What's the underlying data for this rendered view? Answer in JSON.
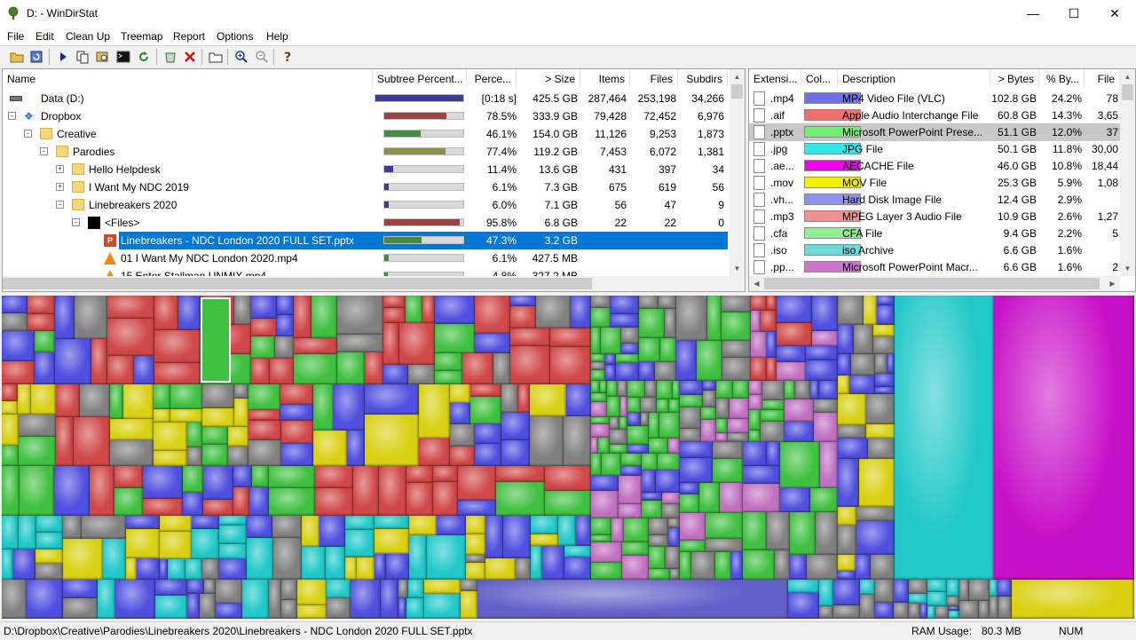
{
  "window": {
    "title": "D: - WinDirStat"
  },
  "menu": [
    "File",
    "Edit",
    "Clean Up",
    "Treemap",
    "Report",
    "Options",
    "Help"
  ],
  "dirtree": {
    "columns": [
      "Name",
      "Subtree Percent...",
      "Perce...",
      "> Size",
      "Items",
      "Files",
      "Subdirs"
    ],
    "rows": [
      {
        "name": "Data (D:)",
        "pct": "[0:18 s]",
        "size": "425.5 GB",
        "items": "287,464",
        "files": "253,198",
        "subdirs": "34,266",
        "bar": 1.0,
        "color": "#3a3aa0"
      },
      {
        "name": "Dropbox",
        "pct": "78.5%",
        "size": "333.9 GB",
        "items": "79,428",
        "files": "72,452",
        "subdirs": "6,976",
        "bar": 0.785,
        "color": "#a04040"
      },
      {
        "name": "Creative",
        "pct": "46.1%",
        "size": "154.0 GB",
        "items": "11,126",
        "files": "9,253",
        "subdirs": "1,873",
        "bar": 0.461,
        "color": "#3f8f3f"
      },
      {
        "name": "Parodies",
        "pct": "77.4%",
        "size": "119.2 GB",
        "items": "7,453",
        "files": "6,072",
        "subdirs": "1,381",
        "bar": 0.774,
        "color": "#8f8f40"
      },
      {
        "name": "Hello Helpdesk",
        "pct": "11.4%",
        "size": "13.6 GB",
        "items": "431",
        "files": "397",
        "subdirs": "34",
        "bar": 0.114,
        "color": "#3a3aa0"
      },
      {
        "name": "I Want My NDC 2019",
        "pct": "6.1%",
        "size": "7.3 GB",
        "items": "675",
        "files": "619",
        "subdirs": "56",
        "bar": 0.061,
        "color": "#3a3aa0"
      },
      {
        "name": "Linebreakers 2020",
        "pct": "6.0%",
        "size": "7.1 GB",
        "items": "56",
        "files": "47",
        "subdirs": "9",
        "bar": 0.06,
        "color": "#3a3aa0"
      },
      {
        "name": "<Files>",
        "pct": "95.8%",
        "size": "6.8 GB",
        "items": "22",
        "files": "22",
        "subdirs": "0",
        "bar": 0.958,
        "color": "#a04040"
      },
      {
        "name": "Linebreakers - NDC London 2020 FULL SET.pptx",
        "pct": "47.3%",
        "size": "3.2 GB",
        "items": "",
        "files": "",
        "subdirs": "",
        "bar": 0.473,
        "color": "#3f8f3f"
      },
      {
        "name": "01 I Want My NDC London 2020.mp4",
        "pct": "6.1%",
        "size": "427.5 MB",
        "items": "",
        "files": "",
        "subdirs": "",
        "bar": 0.061,
        "color": "#3f8f3f"
      },
      {
        "name": "15 Enter Stallman UNMIX.mp4",
        "pct": "4.8%",
        "size": "327.2 MB",
        "items": "",
        "files": "",
        "subdirs": "",
        "bar": 0.048,
        "color": "#3f8f3f"
      }
    ]
  },
  "extlist": {
    "columns": [
      "Extensi...",
      "Col...",
      "Description",
      "> Bytes",
      "% By...",
      "File"
    ],
    "rows": [
      {
        "ext": ".mp4",
        "color": "#6f6ff0",
        "desc": "MP4 Video File (VLC)",
        "bytes": "102.8 GB",
        "pct": "24.2%",
        "files": "78"
      },
      {
        "ext": ".aif",
        "color": "#f07070",
        "desc": "Apple Audio Interchange File",
        "bytes": "60.8 GB",
        "pct": "14.3%",
        "files": "3,65"
      },
      {
        "ext": ".pptx",
        "color": "#70f070",
        "desc": "Microsoft PowerPoint Prese...",
        "bytes": "51.1 GB",
        "pct": "12.0%",
        "files": "37"
      },
      {
        "ext": ".jpg",
        "color": "#30e8e8",
        "desc": "JPG File",
        "bytes": "50.1 GB",
        "pct": "11.8%",
        "files": "30,00"
      },
      {
        "ext": ".ae...",
        "color": "#f000f0",
        "desc": "AECACHE File",
        "bytes": "46.0 GB",
        "pct": "10.8%",
        "files": "18,44"
      },
      {
        "ext": ".mov",
        "color": "#f0f000",
        "desc": "MOV File",
        "bytes": "25.3 GB",
        "pct": "5.9%",
        "files": "1,08"
      },
      {
        "ext": ".vh...",
        "color": "#9090f0",
        "desc": "Hard Disk Image File",
        "bytes": "12.4 GB",
        "pct": "2.9%",
        "files": ""
      },
      {
        "ext": ".mp3",
        "color": "#f09090",
        "desc": "MPEG Layer 3 Audio File",
        "bytes": "10.9 GB",
        "pct": "2.6%",
        "files": "1,27"
      },
      {
        "ext": ".cfa",
        "color": "#90f090",
        "desc": "CFA File",
        "bytes": "9.4 GB",
        "pct": "2.2%",
        "files": "5"
      },
      {
        "ext": ".iso",
        "color": "#70d8d8",
        "desc": "iso Archive",
        "bytes": "6.6 GB",
        "pct": "1.6%",
        "files": ""
      },
      {
        "ext": ".pp...",
        "color": "#d070d0",
        "desc": "Microsoft PowerPoint Macr...",
        "bytes": "6.6 GB",
        "pct": "1.6%",
        "files": "2"
      }
    ]
  },
  "status": {
    "path": "D:\\Dropbox\\Creative\\Parodies\\Linebreakers 2020\\Linebreakers - NDC London 2020 FULL SET.pptx",
    "ram_label": "RAM Usage:",
    "ram_value": "80.3 MB",
    "num": "NUM"
  }
}
